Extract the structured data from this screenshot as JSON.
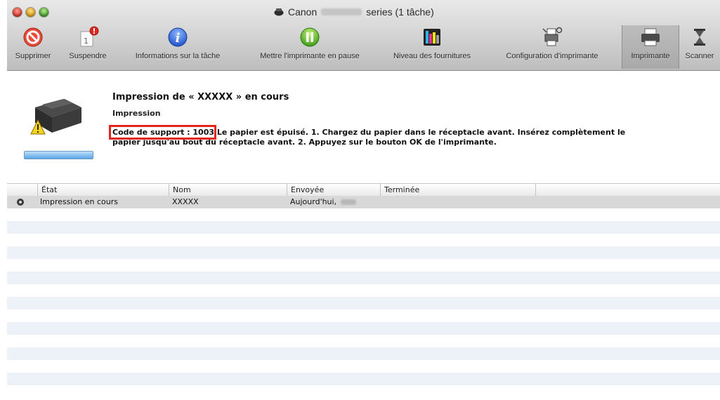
{
  "window": {
    "title_prefix": "Canon",
    "title_suffix": "series (1 tâche)"
  },
  "toolbar": {
    "items": [
      {
        "label": "Supprimer",
        "icon": "delete-icon"
      },
      {
        "label": "Suspendre",
        "icon": "suspend-icon"
      },
      {
        "label": "Informations sur la tâche",
        "icon": "info-icon"
      },
      {
        "label": "Mettre l'imprimante en pause",
        "icon": "pause-icon"
      },
      {
        "label": "Niveau des fournitures",
        "icon": "ink-level-icon"
      },
      {
        "label": "Configuration d'imprimante",
        "icon": "printer-setup-icon"
      },
      {
        "label": "Imprimante",
        "icon": "printer-icon"
      },
      {
        "label": "Scanner",
        "icon": "scanner-icon"
      }
    ],
    "suspend_badge": "1"
  },
  "info": {
    "title": "Impression de « XXXXX » en cours",
    "subtitle": "Impression",
    "support_code": "Code de support : 1003",
    "message": " Le papier est épuisé. 1. Chargez du papier dans le réceptacle avant. Insérez complètement le papier jusqu'au bout du réceptacle avant. 2. Appuyez sur le bouton OK de l'imprimante."
  },
  "table": {
    "columns": [
      "État",
      "Nom",
      "Envoyée",
      "Terminée"
    ],
    "rows": [
      {
        "status": "Impression en cours",
        "name": "XXXXX",
        "sent": "Aujourd'hui,",
        "done": ""
      }
    ]
  },
  "colors": {
    "highlight_box": "#e3261c",
    "progress": "#5aa4e6",
    "row_stripe": "#edf2f9"
  }
}
